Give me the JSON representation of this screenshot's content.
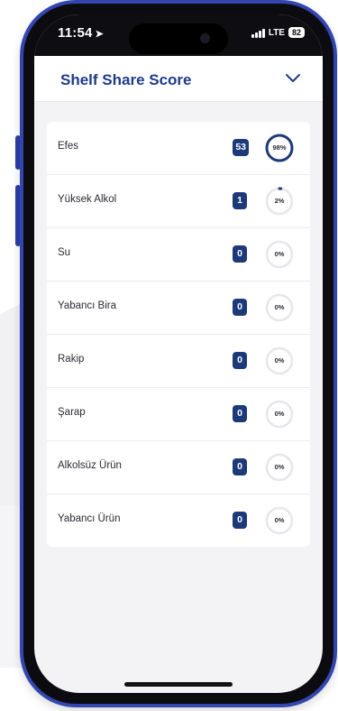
{
  "status_bar": {
    "time": "11:54",
    "carrier": "LTE",
    "battery": "82"
  },
  "header": {
    "title": "Shelf Share Score",
    "chevron_icon": "chevron-down-icon"
  },
  "colors": {
    "title": "#1f3a8a",
    "badge": "#1d3a78",
    "gauge_track": "#e6e6ec",
    "gauge_fill": "#1d3a78",
    "frame": "#3346b0"
  },
  "rows": [
    {
      "label": "Efes",
      "count": "53",
      "percent_label": "98%",
      "percent": 98
    },
    {
      "label": "Yüksek Alkol",
      "count": "1",
      "percent_label": "2%",
      "percent": 2
    },
    {
      "label": "Su",
      "count": "0",
      "percent_label": "0%",
      "percent": 0
    },
    {
      "label": "Yabancı Bira",
      "count": "0",
      "percent_label": "0%",
      "percent": 0
    },
    {
      "label": "Rakip",
      "count": "0",
      "percent_label": "0%",
      "percent": 0
    },
    {
      "label": "Şarap",
      "count": "0",
      "percent_label": "0%",
      "percent": 0
    },
    {
      "label": "Alkolsüz Ürün",
      "count": "0",
      "percent_label": "0%",
      "percent": 0
    },
    {
      "label": "Yabancı Ürün",
      "count": "0",
      "percent_label": "0%",
      "percent": 0
    }
  ]
}
